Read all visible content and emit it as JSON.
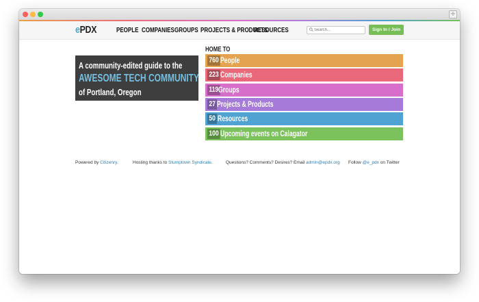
{
  "window": {
    "new_tab_icon": "plus-icon"
  },
  "header": {
    "logo_e": "e",
    "logo_pdx": "PDX",
    "nav": [
      "PEOPLE",
      "COMPANIES",
      "GROUPS",
      "PROJECTS & PRODUCTS",
      "RESOURCES"
    ],
    "search": {
      "icon": "search-icon",
      "placeholder": "Search..."
    },
    "signin_label": "Sign In / Join"
  },
  "hero": {
    "line1": "A community-edited guide to the",
    "line2": "AWESOME TECH COMMUNITY",
    "line3": "of Portland, Oregon"
  },
  "home_to": {
    "heading": "HOME TO",
    "stats": [
      {
        "count": "760",
        "label": "People",
        "color": "#e4a34f"
      },
      {
        "count": "223",
        "label": "Companies",
        "color": "#e9687a"
      },
      {
        "count": "119",
        "label": "Groups",
        "color": "#d76fca"
      },
      {
        "count": "27",
        "label": "Projects & Products",
        "color": "#a57ad8"
      },
      {
        "count": "50",
        "label": "Resources",
        "color": "#4fa2d2"
      },
      {
        "count": "100",
        "label": "Upcoming events on Calagator",
        "color": "#7bc15c"
      }
    ]
  },
  "footer": {
    "powered_prefix": "Powered by ",
    "powered_link": "Citizenry",
    "powered_suffix": ".",
    "hosting_prefix": "Hosting thanks to ",
    "hosting_link": "Stumptown Syndicate",
    "hosting_suffix": ".",
    "questions_prefix": "Questions? Comments? Desires? Email ",
    "questions_link": "admin@epdx.org",
    "follow_prefix": "Follow ",
    "follow_link": "@e_pdx",
    "follow_suffix": " on Twitter"
  }
}
